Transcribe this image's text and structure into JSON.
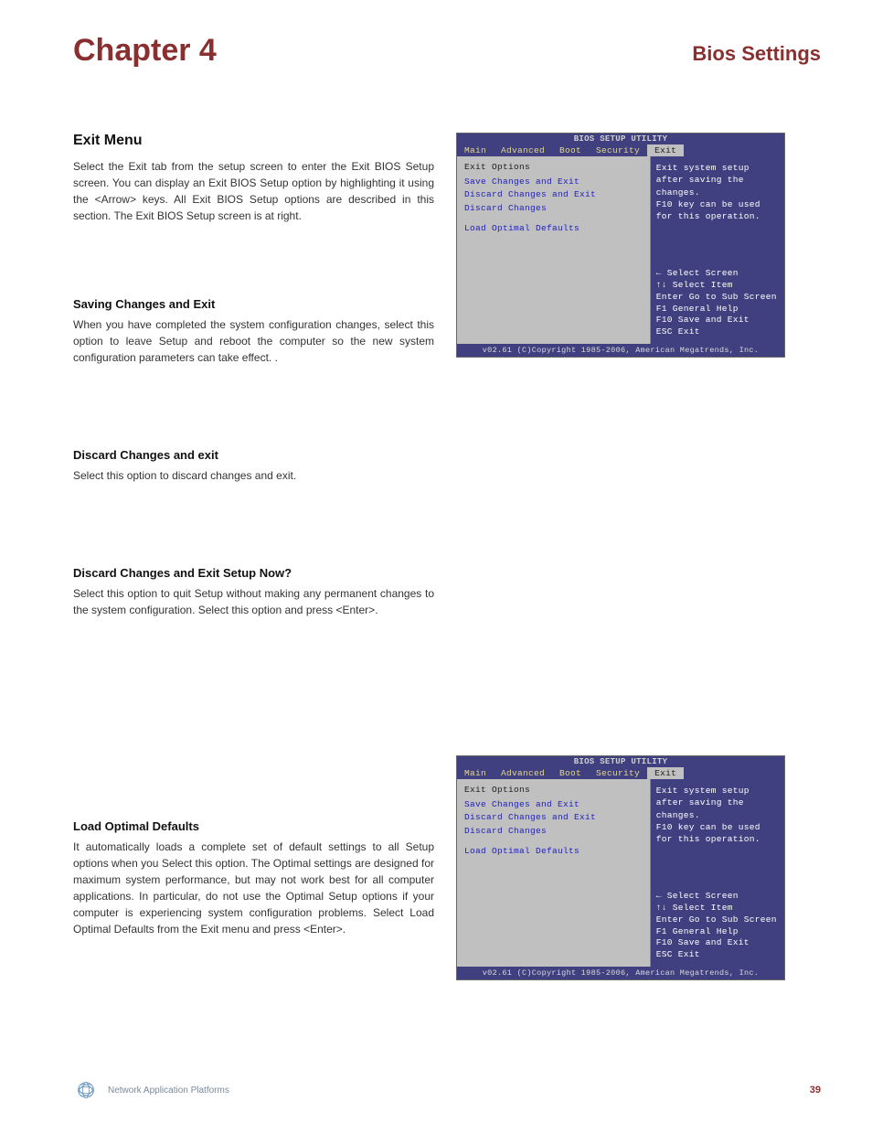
{
  "header": {
    "chapter": "Chapter 4",
    "right_title": "Bios Settings"
  },
  "left": {
    "exit_menu": {
      "title": "Exit Menu",
      "body": "Select the Exit tab from the setup screen to enter the Exit BIOS Setup screen. You can display an Exit BIOS Setup option by highlighting it using the <Arrow> keys. All Exit BIOS Setup options are described in this section. The Exit BIOS Setup screen is at right."
    },
    "save_exit": {
      "title": "Saving Changes and Exit",
      "body": "When you have completed the system configuration changes, select this option to leave Setup and reboot the computer so the new system configuration parameters can take effect. ."
    },
    "discard_exit": {
      "title": "Discard Changes and exit",
      "body": "Select this option to discard changes and exit."
    },
    "discard_now": {
      "title": "Discard Changes and Exit Setup Now?",
      "body": "Select this option to quit Setup without making any permanent changes to the system configuration. Select this option and press <Enter>."
    },
    "load_optimal": {
      "title": "Load Optimal Defaults",
      "body": "It automatically loads a complete set of default settings to all Setup options when you Select this option. The Optimal settings are designed for maximum system performance, but may not work best for all computer applications. In particular, do not use the Optimal Setup options if your computer is experiencing system configuration problems. Select Load Optimal Defaults from the Exit menu and press <Enter>."
    }
  },
  "bios": {
    "title": "BIOS SETUP UTILITY",
    "tabs": [
      "Main",
      "Advanced",
      "Boot",
      "Security",
      "Exit"
    ],
    "opt_header": "Exit Options",
    "options": [
      "Save Changes and Exit",
      "Discard Changes and Exit",
      "Discard Changes",
      "Load Optimal Defaults"
    ],
    "help_top": [
      "Exit system setup",
      "after saving the",
      "changes.",
      "",
      "F10 key can be used",
      "for this operation."
    ],
    "help_bot": [
      "←    Select Screen",
      "↑↓   Select Item",
      "Enter Go to Sub Screen",
      "F1   General Help",
      "F10  Save and Exit",
      "ESC  Exit"
    ],
    "footer": "v02.61 (C)Copyright 1985-2006, American Megatrends, Inc."
  },
  "footer": {
    "text": "Network Application Platforms",
    "page": "39"
  }
}
